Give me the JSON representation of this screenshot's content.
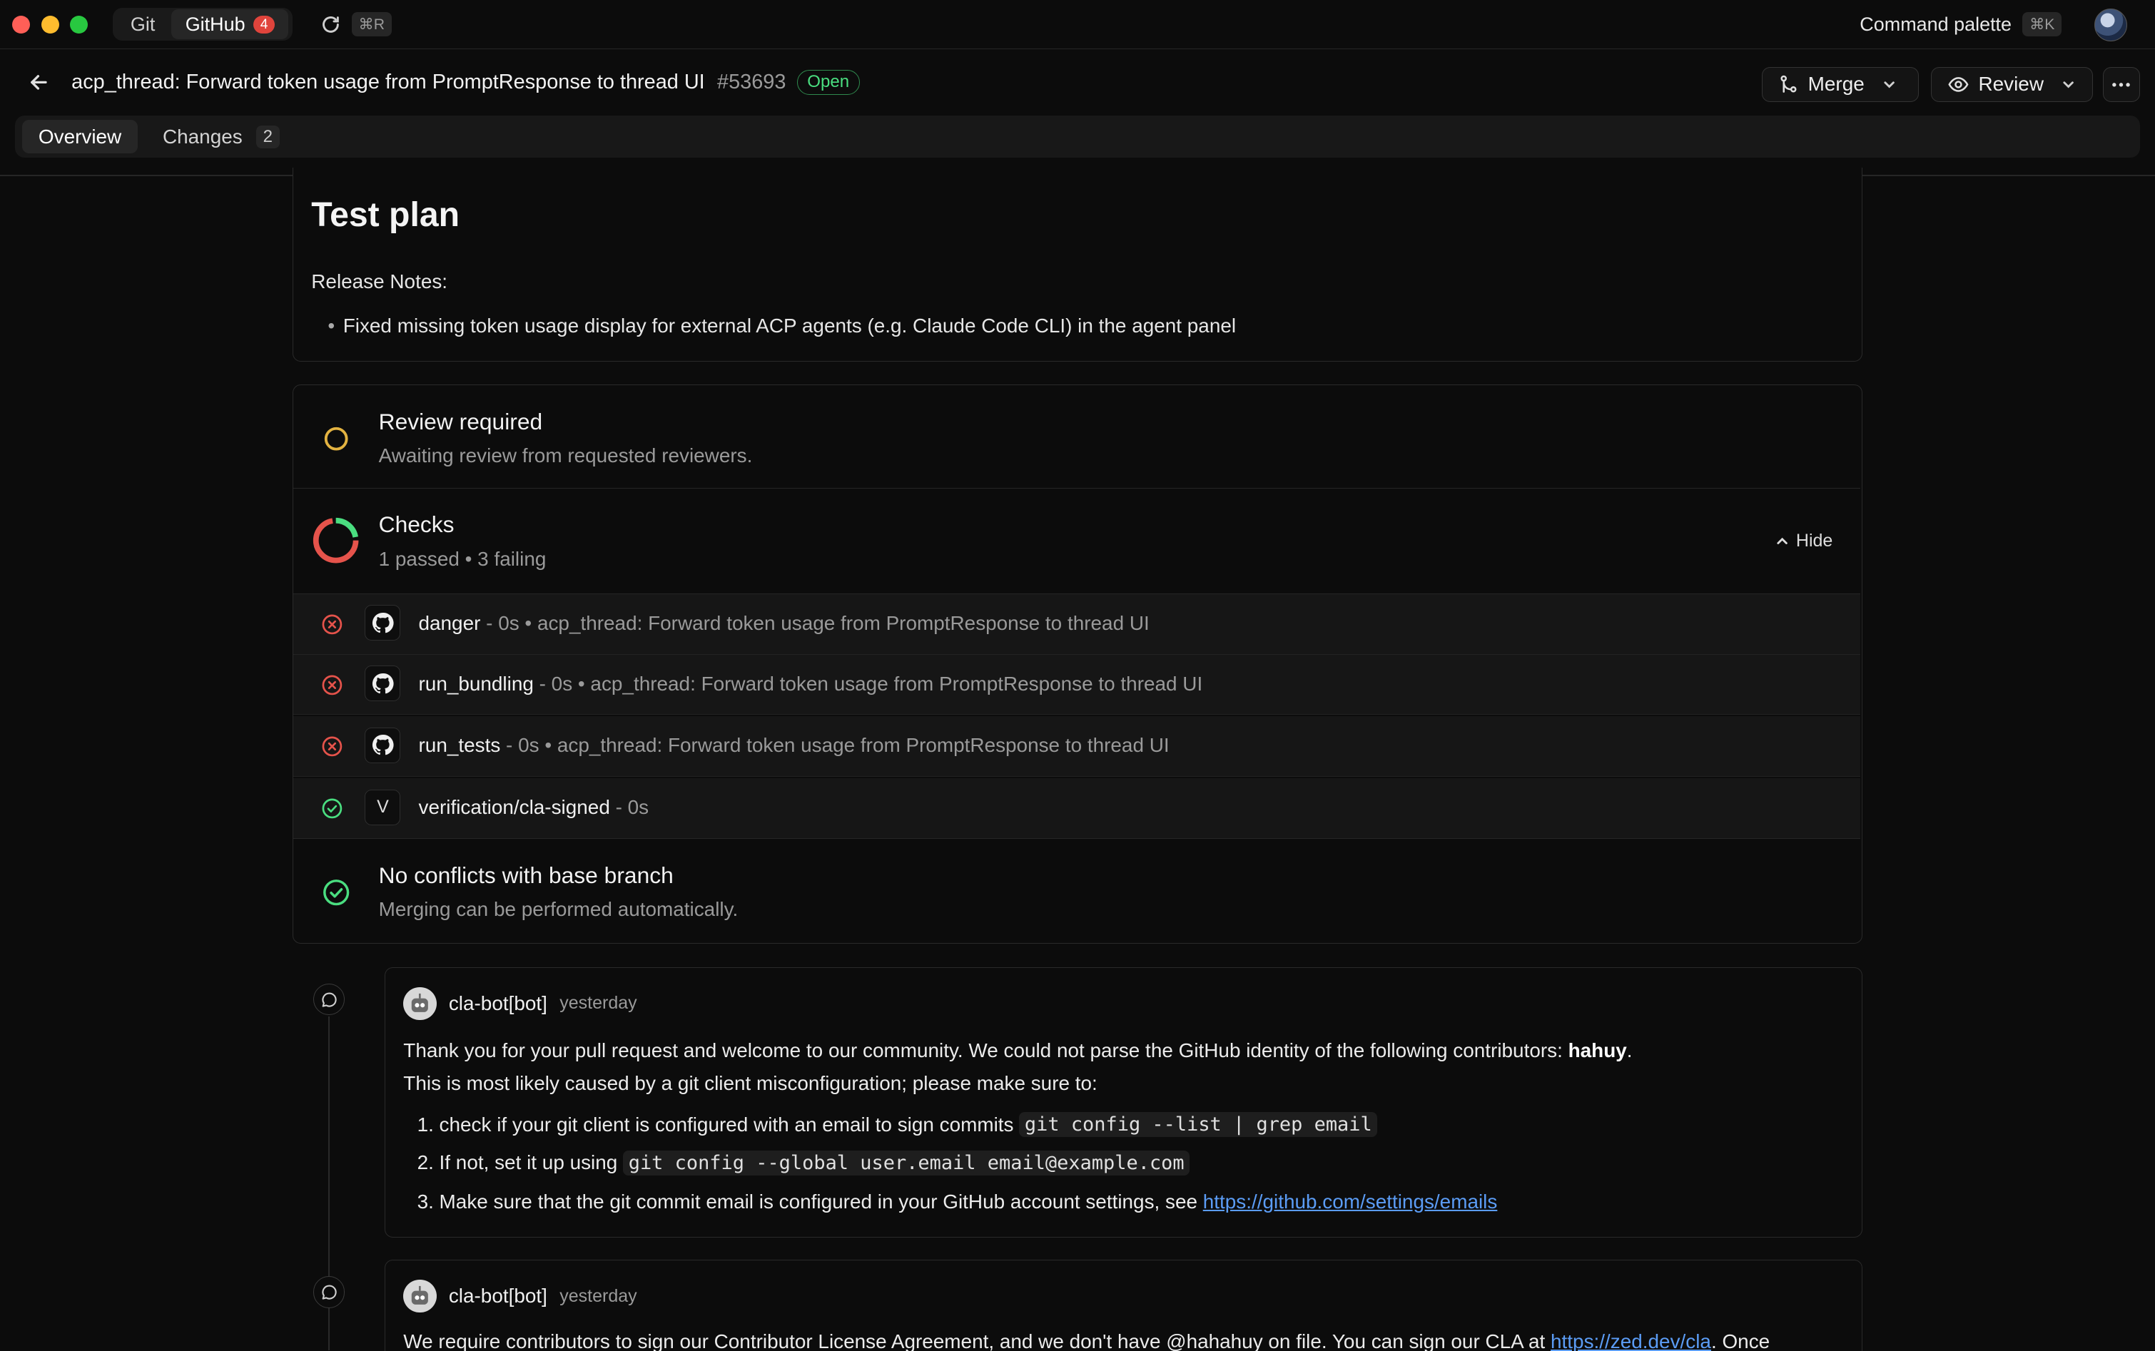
{
  "titlebar": {
    "tabs": [
      {
        "label": "Git"
      },
      {
        "label": "GitHub",
        "badge": "4"
      }
    ],
    "refresh_shortcut": "⌘R",
    "command_palette_label": "Command palette",
    "command_palette_shortcut": "⌘K"
  },
  "pr": {
    "title": "acp_thread: Forward token usage from PromptResponse to thread UI",
    "number": "#53693",
    "state": "Open",
    "merge_label": "Merge",
    "review_label": "Review"
  },
  "tabs": [
    {
      "label": "Overview",
      "active": true
    },
    {
      "label": "Changes",
      "count": "2"
    }
  ],
  "test_plan": {
    "heading": "Test plan",
    "release_notes_label": "Release Notes:",
    "bullets": [
      "Fixed missing token usage display for external ACP agents (e.g. Claude Code CLI) in the agent panel"
    ]
  },
  "status": {
    "review": {
      "title": "Review required",
      "subtitle": "Awaiting review from requested reviewers."
    },
    "checks": {
      "title": "Checks",
      "summary": "1 passed • 3 failing",
      "passed": 1,
      "failing": 3,
      "hide_label": "Hide",
      "items": [
        {
          "name": "danger",
          "meta": " - 0s • acp_thread: Forward token usage from PromptResponse to thread UI",
          "state": "failed",
          "source": "github"
        },
        {
          "name": "run_bundling",
          "meta": " - 0s • acp_thread: Forward token usage from PromptResponse to thread UI",
          "state": "failed",
          "source": "github"
        },
        {
          "name": "run_tests",
          "meta": " - 0s • acp_thread: Forward token usage from PromptResponse to thread UI",
          "state": "failed",
          "source": "github"
        },
        {
          "name": "verification/cla-signed",
          "meta": " - 0s",
          "state": "passed",
          "source": "V"
        }
      ]
    },
    "conflicts": {
      "title": "No conflicts with base branch",
      "subtitle": "Merging can be performed automatically."
    }
  },
  "comments": [
    {
      "author": "cla-bot[bot]",
      "time": "yesterday",
      "intro": "Thank you for your pull request and welcome to our community. We could not parse the GitHub identity of the following contributors: ",
      "intro_bold": "hahuy",
      "intro_end": ".",
      "line2": "This is most likely caused by a git client misconfiguration; please make sure to:",
      "steps": [
        {
          "num": "1.",
          "text": "check if your git client is configured with an email to sign commits",
          "code": "git config --list | grep email"
        },
        {
          "num": "2.",
          "text": "If not, set it up using",
          "code": "git config --global user.email email@example.com"
        },
        {
          "num": "3.",
          "text": "Make sure that the git commit email is configured in your GitHub account settings, see",
          "link": "https://github.com/settings/emails"
        }
      ]
    },
    {
      "author": "cla-bot[bot]",
      "time": "yesterday",
      "text_start": "We require contributors to sign our Contributor License Agreement, and we don't have @hahahuy on file. You can sign our CLA at ",
      "link": "https://zed.dev/cla",
      "text_end": ". Once"
    }
  ],
  "colors": {
    "accent_open": "#4ade80",
    "failed": "#e5534b",
    "passed": "#4ade80",
    "pending": "#e3b341",
    "link": "#5b9cf5"
  }
}
